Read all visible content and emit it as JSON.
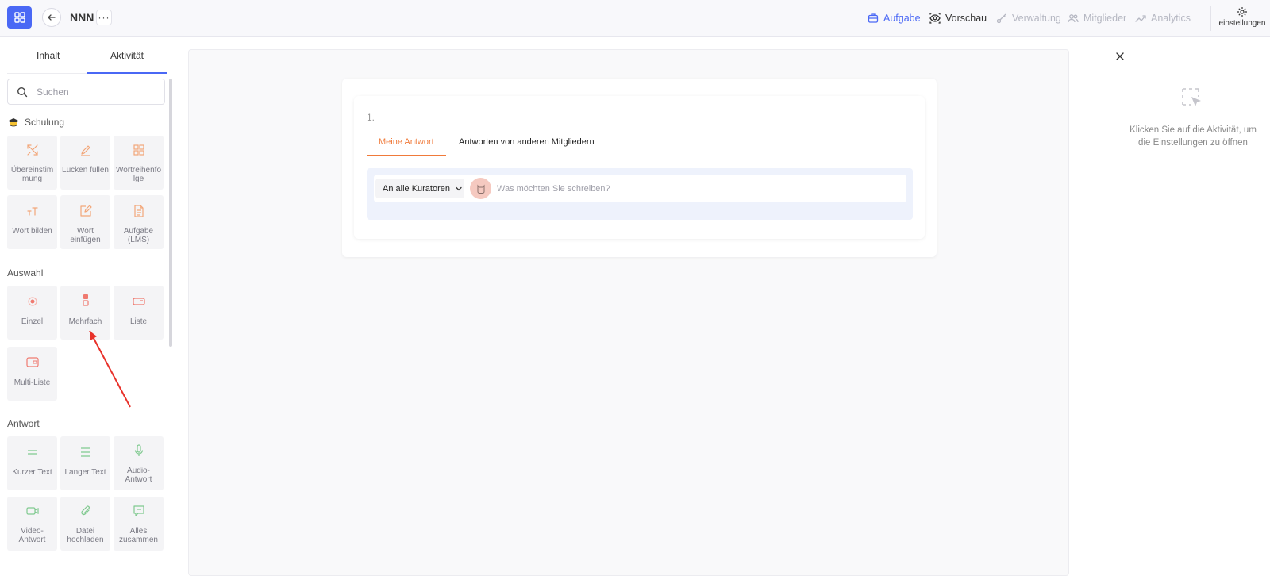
{
  "topbar": {
    "project_title": "NNN",
    "more_label": "···",
    "nav": [
      {
        "label": "Aufgabe",
        "icon": "briefcase-icon",
        "state": "active"
      },
      {
        "label": "Vorschau",
        "icon": "eye-icon",
        "state": "normal"
      },
      {
        "label": "Verwaltung",
        "icon": "key-icon",
        "state": "disabled"
      },
      {
        "label": "Mitglieder",
        "icon": "users-icon",
        "state": "disabled"
      },
      {
        "label": "Analytics",
        "icon": "trend-icon",
        "state": "disabled"
      }
    ],
    "settings_label": "einstellungen",
    "accent_color": "#4a68f5"
  },
  "sidebar": {
    "tabs": [
      {
        "label": "Inhalt",
        "active": false
      },
      {
        "label": "Aktivität",
        "active": true
      }
    ],
    "search_placeholder": "Suchen",
    "sections": [
      {
        "title": "Schulung",
        "icon": "graduation-cap-icon",
        "color": "#f29a6b",
        "items": [
          {
            "label": "Übereinstim mung",
            "icon": "match-icon"
          },
          {
            "label": "Lücken füllen",
            "icon": "pencil-icon"
          },
          {
            "label": "Wortreihenfo lge",
            "icon": "grid-icon"
          },
          {
            "label": "Wort bilden",
            "icon": "text-size-icon"
          },
          {
            "label": "Wort einfügen",
            "icon": "edit-box-icon"
          },
          {
            "label": "Aufgabe (LMS)",
            "icon": "document-icon"
          }
        ]
      },
      {
        "title": "Auswahl",
        "color": "#ef8a8a",
        "items": [
          {
            "label": "Einzel",
            "icon": "radio-icon"
          },
          {
            "label": "Mehrfach",
            "icon": "checkbox-stack-icon"
          },
          {
            "label": "Liste",
            "icon": "dropdown-icon"
          },
          {
            "label": "Multi-Liste",
            "icon": "multi-dropdown-icon"
          }
        ]
      },
      {
        "title": "Antwort",
        "color": "#7fc98f",
        "items": [
          {
            "label": "Kurzer Text",
            "icon": "short-text-icon"
          },
          {
            "label": "Langer Text",
            "icon": "long-text-icon"
          },
          {
            "label": "Audio-Antwort",
            "icon": "microphone-icon"
          },
          {
            "label": "Video-Antwort",
            "icon": "video-icon"
          },
          {
            "label": "Datei hochladen",
            "icon": "paperclip-icon"
          },
          {
            "label": "Alles zusammen",
            "icon": "chat-icon"
          }
        ]
      }
    ]
  },
  "main": {
    "question_number": "1.",
    "answer_tabs": [
      {
        "label": "Meine Antwort",
        "active": true
      },
      {
        "label": "Antworten von anderen Mitgliedern",
        "active": false
      }
    ],
    "audience_select": "An alle Kuratoren",
    "reply_placeholder": "Was möchten Sie schreiben?",
    "active_tab_color": "#f07a3a"
  },
  "right_panel": {
    "empty_text": "Klicken Sie auf die Aktivität, um die Einstellungen zu öffnen"
  }
}
